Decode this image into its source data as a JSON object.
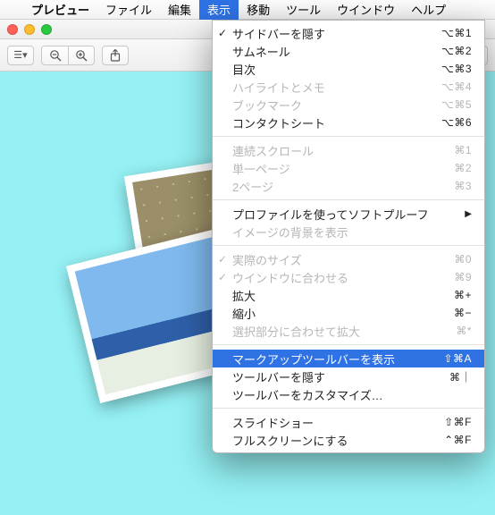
{
  "menubar": {
    "app": "プレビュー",
    "items": [
      "ファイル",
      "編集",
      "表示",
      "移動",
      "ツール",
      "ウインドウ",
      "ヘルプ"
    ],
    "activeIndex": 2
  },
  "toolbar": {
    "sidebar": "☰▾",
    "zoomOut": "−",
    "zoomIn": "+",
    "share": "⇪",
    "markup": "✎",
    "search": "⌕"
  },
  "menu": [
    {
      "label": "サイドバーを隠す",
      "shortcut": "⌥⌘1",
      "checked": true
    },
    {
      "label": "サムネール",
      "shortcut": "⌥⌘2"
    },
    {
      "label": "目次",
      "shortcut": "⌥⌘3"
    },
    {
      "label": "ハイライトとメモ",
      "shortcut": "⌥⌘4",
      "disabled": true
    },
    {
      "label": "ブックマーク",
      "shortcut": "⌥⌘5",
      "disabled": true
    },
    {
      "label": "コンタクトシート",
      "shortcut": "⌥⌘6"
    },
    {
      "sep": true
    },
    {
      "label": "連続スクロール",
      "shortcut": "⌘1",
      "disabled": true
    },
    {
      "label": "単一ページ",
      "shortcut": "⌘2",
      "disabled": true
    },
    {
      "label": "2ページ",
      "shortcut": "⌘3",
      "disabled": true
    },
    {
      "sep": true
    },
    {
      "label": "プロファイルを使ってソフトプルーフ",
      "submenu": true
    },
    {
      "label": "イメージの背景を表示",
      "disabled": true
    },
    {
      "sep": true
    },
    {
      "label": "実際のサイズ",
      "shortcut": "⌘0",
      "checked": true,
      "disabled": true
    },
    {
      "label": "ウインドウに合わせる",
      "shortcut": "⌘9",
      "checked": true,
      "disabled": true
    },
    {
      "label": "拡大",
      "shortcut": "⌘+"
    },
    {
      "label": "縮小",
      "shortcut": "⌘−"
    },
    {
      "label": "選択部分に合わせて拡大",
      "shortcut": "⌘*",
      "disabled": true
    },
    {
      "sep": true
    },
    {
      "label": "マークアップツールバーを表示",
      "shortcut": "⇧⌘A",
      "selected": true
    },
    {
      "label": "ツールバーを隠す",
      "shortcut": "⌘｜"
    },
    {
      "label": "ツールバーをカスタマイズ…"
    },
    {
      "sep": true
    },
    {
      "label": "スライドショー",
      "shortcut": "⇧⌘F"
    },
    {
      "label": "フルスクリーンにする",
      "shortcut": "⌃⌘F"
    }
  ]
}
